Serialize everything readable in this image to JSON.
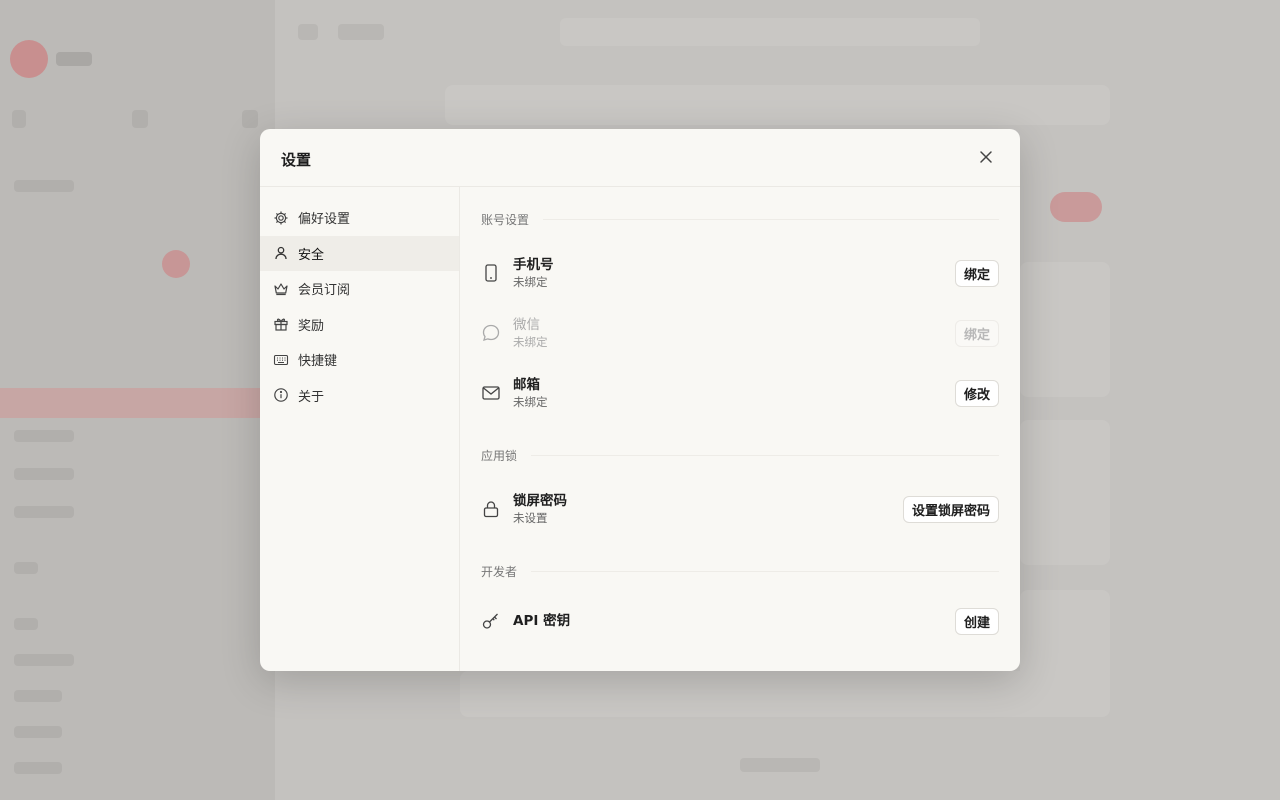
{
  "modal": {
    "title": "设置"
  },
  "nav": [
    {
      "label": "偏好设置",
      "icon": "gear-icon"
    },
    {
      "label": "安全",
      "icon": "user-icon",
      "active": true
    },
    {
      "label": "会员订阅",
      "icon": "crown-icon"
    },
    {
      "label": "奖励",
      "icon": "gift-icon"
    },
    {
      "label": "快捷键",
      "icon": "keyboard-icon"
    },
    {
      "label": "关于",
      "icon": "info-icon"
    }
  ],
  "account": {
    "section_title": "账号设置",
    "phone": {
      "label": "手机号",
      "status": "未绑定",
      "button": "绑定",
      "icon": "phone-icon"
    },
    "wechat": {
      "label": "微信",
      "status": "未绑定",
      "button": "绑定",
      "icon": "chat-bubble-icon",
      "disabled": true
    },
    "email": {
      "label": "邮箱",
      "status": "未绑定",
      "button": "修改",
      "icon": "mail-icon"
    }
  },
  "applock": {
    "section_title": "应用锁",
    "lock": {
      "label": "锁屏密码",
      "status": "未设置",
      "button": "设置锁屏密码",
      "icon": "lock-icon"
    }
  },
  "developer": {
    "section_title": "开发者",
    "api": {
      "label": "API 密钥",
      "button": "创建",
      "icon": "key-icon"
    }
  },
  "colors": {
    "modal_bg": "#f9f8f4",
    "active_nav_bg": "#efede8",
    "overlay": "#bdbbb8"
  }
}
